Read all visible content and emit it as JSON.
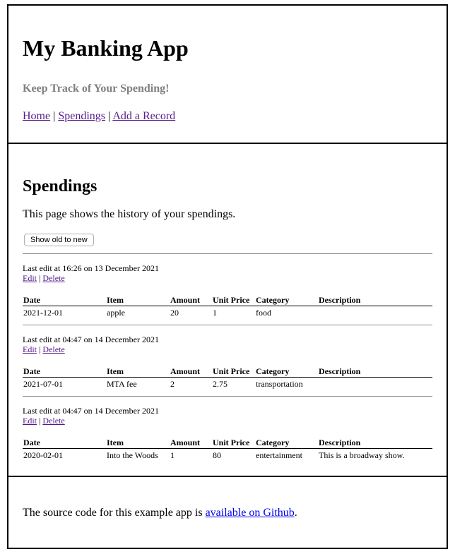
{
  "header": {
    "title": "My Banking App",
    "tagline": "Keep Track of Your Spending!",
    "nav": [
      {
        "label": "Home"
      },
      {
        "label": "Spendings"
      },
      {
        "label": "Add a Record"
      }
    ],
    "separator": "|"
  },
  "main": {
    "heading": "Spendings",
    "intro": "This page shows the history of your spendings.",
    "sort_button": "Show old to new",
    "columns": [
      "Date",
      "Item",
      "Amount",
      "Unit Price",
      "Category",
      "Description"
    ],
    "edit_label": "Edit",
    "delete_label": "Delete",
    "records": [
      {
        "last_edit": "Last edit at 16:26 on 13 December 2021",
        "date": "2021-12-01",
        "item": "apple",
        "amount": "20",
        "unit_price": "1",
        "category": "food",
        "description": ""
      },
      {
        "last_edit": "Last edit at 04:47 on 14 December 2021",
        "date": "2021-07-01",
        "item": "MTA fee",
        "amount": "2",
        "unit_price": "2.75",
        "category": "transportation",
        "description": ""
      },
      {
        "last_edit": "Last edit at 04:47 on 14 December 2021",
        "date": "2020-02-01",
        "item": "Into the Woods",
        "amount": "1",
        "unit_price": "80",
        "category": "entertainment",
        "description": "This is a broadway show."
      }
    ]
  },
  "footer": {
    "text_before": "The source code for this example app is ",
    "link_label": "available on Github",
    "text_after": "."
  },
  "colors": {
    "link": "#0000ee",
    "visited_link": "#551a8b",
    "tagline": "#808080"
  }
}
